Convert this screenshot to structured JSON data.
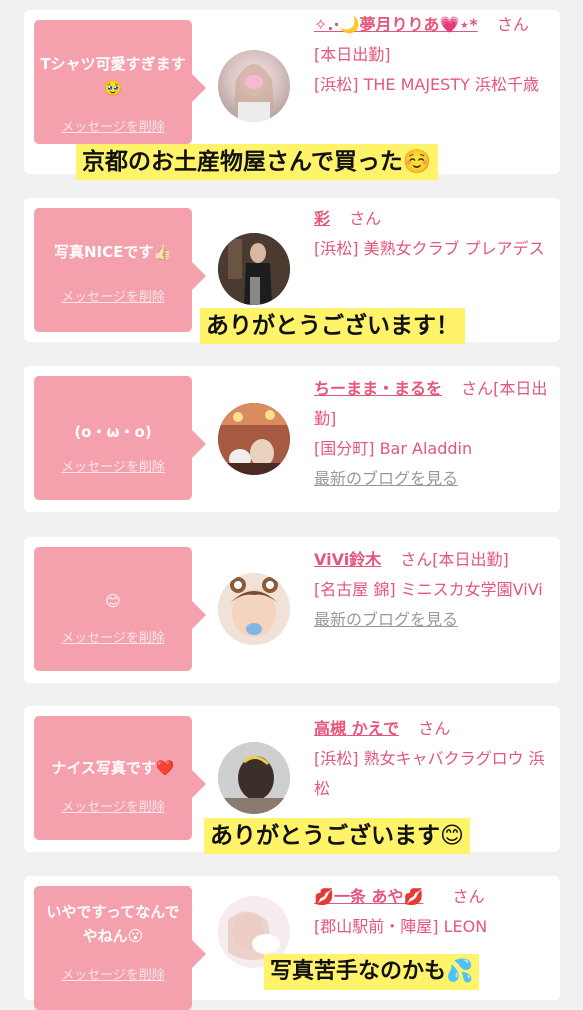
{
  "cards": [
    {
      "message": "Tシャツ可愛すぎます🥹",
      "delete_label": "メッセージを削除",
      "name": "✧.·🌙夢月りりあ💗⋆*",
      "san": "さん",
      "status": "[本日出勤]",
      "shop": "[浜松] THE MAJESTY 浜松千歳",
      "caption": "京都のお土産物屋さんで買った☺️"
    },
    {
      "message": "写真NICEです👍🏻",
      "delete_label": "メッセージを削除",
      "name": "彩",
      "san": "さん",
      "shop": "[浜松] 美熟女クラブ プレアデス",
      "caption": "ありがとうございます！"
    },
    {
      "message": "(o・ω・o)",
      "delete_label": "メッセージを削除",
      "name": "ちーまま・まるを",
      "san": "さん",
      "status": "[本日出勤]",
      "shop": "[国分町] Bar Aladdin",
      "blog": "最新のブログを見る"
    },
    {
      "message": "😊",
      "delete_label": "メッセージを削除",
      "name": "ViVi鈴木",
      "san": "さん",
      "status": "[本日出勤]",
      "shop": "[名古屋 錦] ミニスカ女学園ViVi",
      "blog": "最新のブログを見る"
    },
    {
      "message": "ナイス写真です❤️",
      "delete_label": "メッセージを削除",
      "name": "高槻 かえで",
      "san": "さん",
      "shop": "[浜松] 熟女キャバクラグロウ 浜松",
      "caption": "ありがとうございます😊"
    },
    {
      "message": "いやですってなんでやねん😮",
      "delete_label": "メッセージを削除",
      "name": "💋一条 あや💋",
      "san": "さん",
      "shop": "[郡山駅前・陣屋] LEON",
      "caption": "写真苦手なのかも💦"
    }
  ],
  "colors": {
    "bubble": "#f5a0ad",
    "link": "#e4567a",
    "caption_bg": "#fff36a",
    "page_bg": "#f1f1f1"
  }
}
